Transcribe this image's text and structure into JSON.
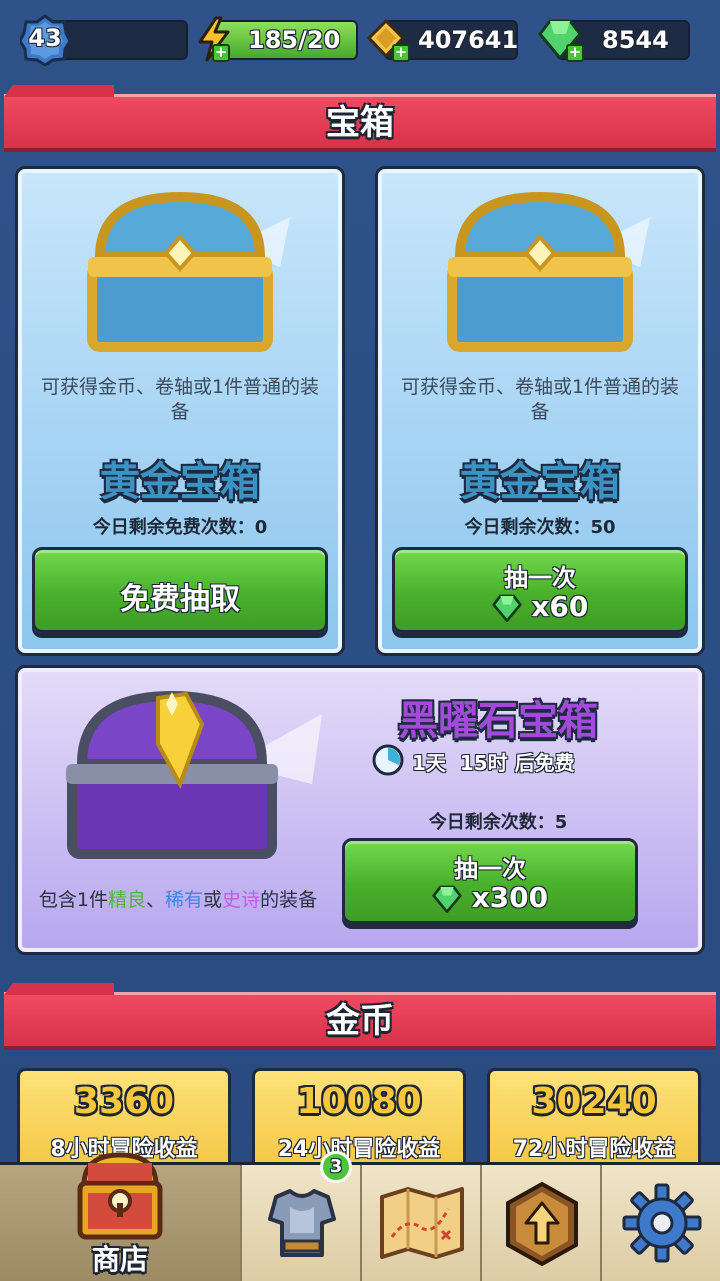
{
  "topbar": {
    "level": "43",
    "energy": "185/20",
    "coins": "407641",
    "gems": "8544"
  },
  "sections": {
    "chests_title": "宝箱",
    "gold_title": "金币"
  },
  "chests": [
    {
      "desc": "可获得金币、卷轴或1件普通的装备",
      "title": "黄金宝箱",
      "remaining": "今日剩余免费次数：0",
      "button_label": "免费抽取"
    },
    {
      "desc": "可获得金币、卷轴或1件普通的装备",
      "title": "黄金宝箱",
      "remaining": "今日剩余次数：50",
      "button_label": "抽一次",
      "cost": "x60"
    }
  ],
  "obsidian": {
    "title": "黑曜石宝箱",
    "timer": "1天  15时 后免费",
    "remaining": "今日剩余次数：5",
    "button_label": "抽一次",
    "cost": "x300",
    "desc_prefix": "包含1件",
    "desc_q1": "精良",
    "desc_sep1": "、",
    "desc_q2": "稀有",
    "desc_sep2": "或",
    "desc_q3": "史诗",
    "desc_suffix": "的装备"
  },
  "gold_offers": [
    {
      "amount": "3360",
      "label": "8小时冒险收益"
    },
    {
      "amount": "10080",
      "label": "24小时冒险收益"
    },
    {
      "amount": "30240",
      "label": "72小时冒险收益"
    }
  ],
  "nav": {
    "shop_label": "商店",
    "equipment_badge": "3"
  },
  "colors": {
    "common_green": "#6ad148",
    "rare_blue": "#3d86e6",
    "epic_purple": "#c55ae6",
    "header_red": "#e23d55"
  },
  "icons": [
    "level-badge-icon",
    "lightning-icon",
    "coin-scroll-icon",
    "gem-icon",
    "chest-icon",
    "armor-icon",
    "map-icon",
    "upgrade-icon",
    "gear-icon",
    "clock-icon"
  ]
}
